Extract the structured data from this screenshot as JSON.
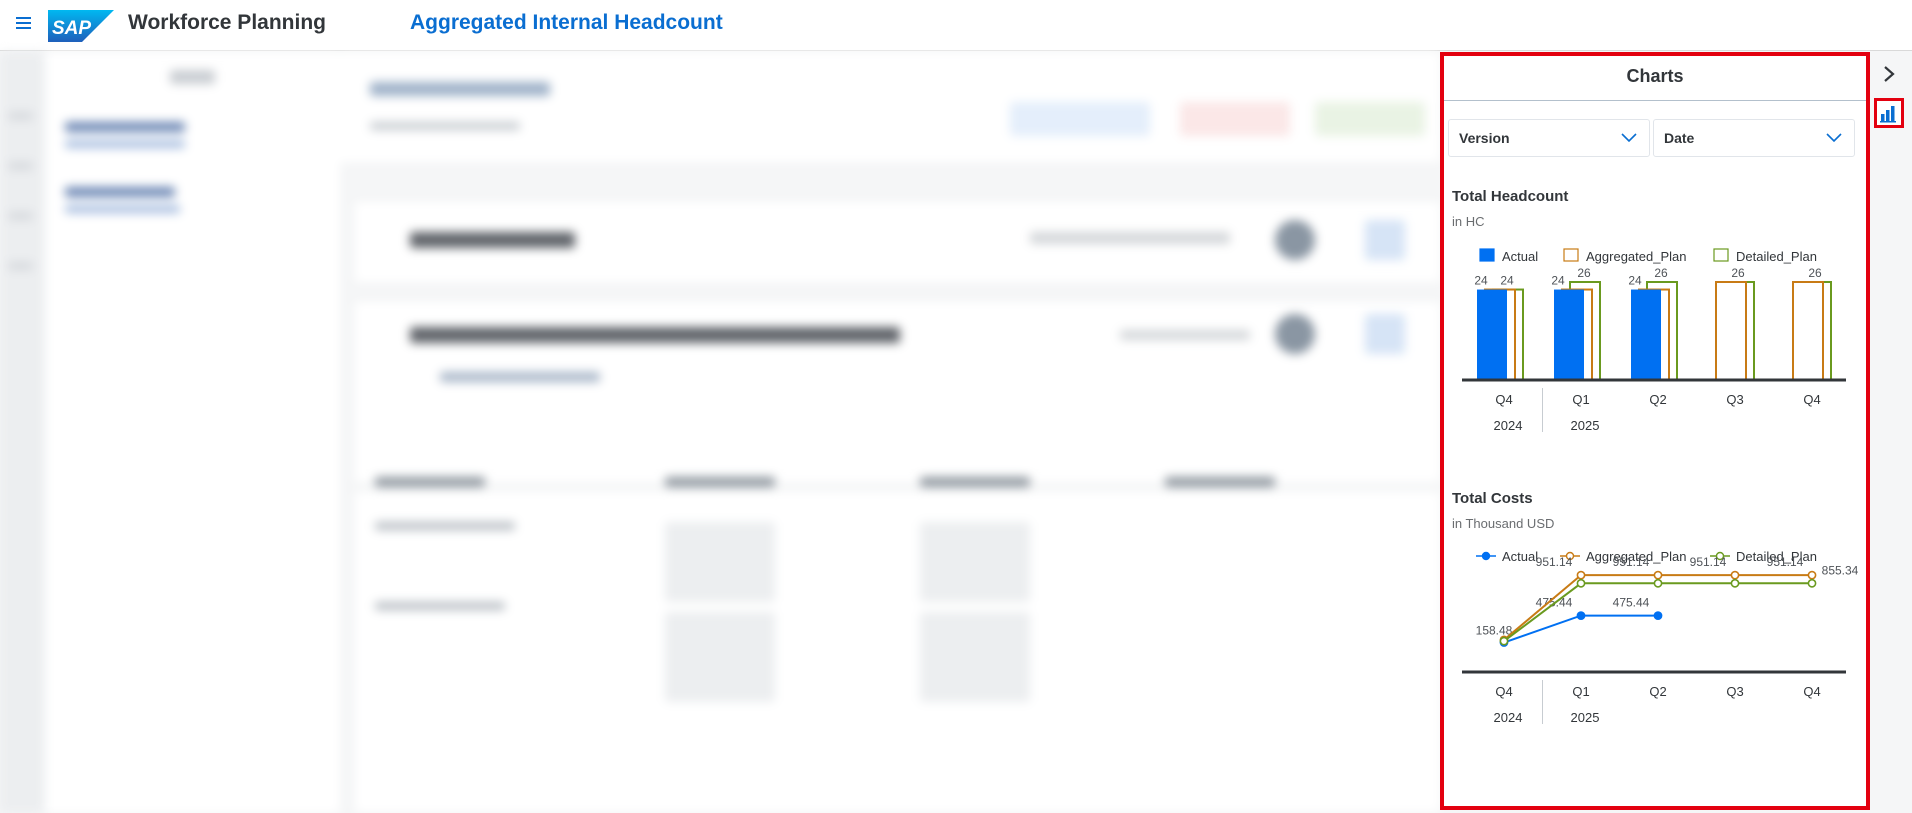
{
  "shell": {
    "app_title": "Workforce Planning",
    "page_title": "Aggregated Internal Headcount",
    "logo_text": "SAP"
  },
  "panel": {
    "title": "Charts",
    "filters": {
      "version": "Version",
      "date": "Date"
    }
  },
  "headcount_chart": {
    "title": "Total Headcount",
    "subtitle": "in HC"
  },
  "costs_chart": {
    "title": "Total Costs",
    "subtitle": "in Thousand USD"
  },
  "colors": {
    "actual": "#0070f2",
    "aggregated_plan": "#c87b15",
    "detailed_plan": "#6a9a1f",
    "highlight": "#e3000f",
    "brand": "#0a6ed1"
  },
  "icons": [
    "menu-icon",
    "sap-logo",
    "chevron-down-icon",
    "chevron-right-icon",
    "bar-chart-icon"
  ],
  "chart_data": [
    {
      "type": "bar",
      "title": "Total Headcount",
      "subtitle": "in HC",
      "categories": [
        "Q4",
        "Q1",
        "Q2",
        "Q3",
        "Q4"
      ],
      "years": [
        {
          "label": "2024",
          "start": 0
        },
        {
          "label": "2025",
          "start": 1
        }
      ],
      "series": [
        {
          "name": "Actual",
          "values": [
            24,
            24,
            24,
            null,
            null
          ]
        },
        {
          "name": "Aggregated_Plan",
          "values": [
            24,
            24,
            24,
            26,
            26
          ]
        },
        {
          "name": "Detailed_Plan",
          "values": [
            24,
            26,
            26,
            26,
            26
          ]
        }
      ],
      "data_labels": [
        [
          "24",
          "24"
        ],
        [
          "24",
          "26"
        ],
        [
          "24",
          "26"
        ],
        [
          "26"
        ],
        [
          "26"
        ]
      ],
      "ylim": [
        0,
        26
      ],
      "legend": "top"
    },
    {
      "type": "line",
      "title": "Total Costs",
      "subtitle": "in Thousand USD",
      "categories": [
        "Q4",
        "Q1",
        "Q2",
        "Q3",
        "Q4"
      ],
      "years": [
        {
          "label": "2024",
          "start": 0
        },
        {
          "label": "2025",
          "start": 1
        }
      ],
      "series": [
        {
          "name": "Actual",
          "values": [
            158.48,
            475.44,
            475.44,
            null,
            null
          ],
          "labels": [
            "158.48",
            "475.44",
            "475.44",
            "",
            ""
          ]
        },
        {
          "name": "Aggregated_Plan",
          "values": [
            190,
            951.14,
            951.14,
            951.14,
            951.14
          ],
          "labels": [
            "",
            "951.14",
            "951.14",
            "951.14",
            "951.14"
          ]
        },
        {
          "name": "Detailed_Plan",
          "values": [
            175,
            855.34,
            855.34,
            855.34,
            855.34
          ],
          "labels": [
            "",
            "",
            "",
            "",
            "855.34"
          ]
        }
      ],
      "ylim": [
        0,
        1000
      ],
      "legend": "top"
    }
  ]
}
